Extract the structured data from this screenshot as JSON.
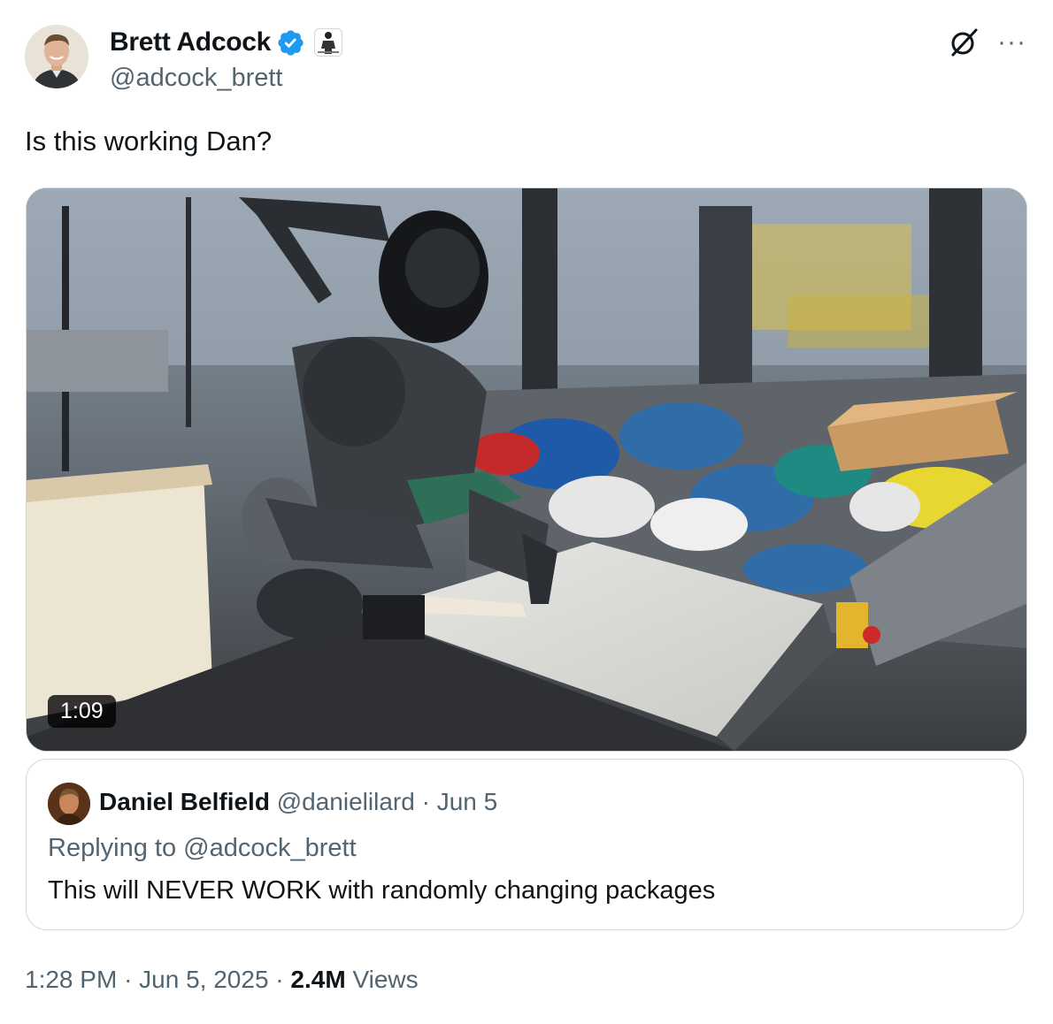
{
  "author": {
    "name": "Brett Adcock",
    "handle": "@adcock_brett",
    "verified_badge_color": "#1d9bf0",
    "icons": [
      "verified-badge-icon",
      "affiliation-robot-icon"
    ]
  },
  "top_icons": {
    "grok": "grok-icon",
    "more": "···"
  },
  "tweet": {
    "text": "Is this working Dan?"
  },
  "media": {
    "duration": "1:09"
  },
  "quote": {
    "name": "Daniel Belfield",
    "handle": "@danielilard",
    "separator": "·",
    "date": "Jun 5",
    "replying_prefix": "Replying to",
    "replying_to": "@adcock_brett",
    "text": "This will NEVER WORK with randomly changing packages"
  },
  "meta": {
    "time": "1:28 PM",
    "sep1": "·",
    "date": "Jun 5, 2025",
    "sep2": "·",
    "views_count": "2.4M",
    "views_label": "Views"
  },
  "colors": {
    "text": "#0f1419",
    "secondary": "#536471",
    "border": "#cfd9de",
    "accent": "#1d9bf0"
  }
}
